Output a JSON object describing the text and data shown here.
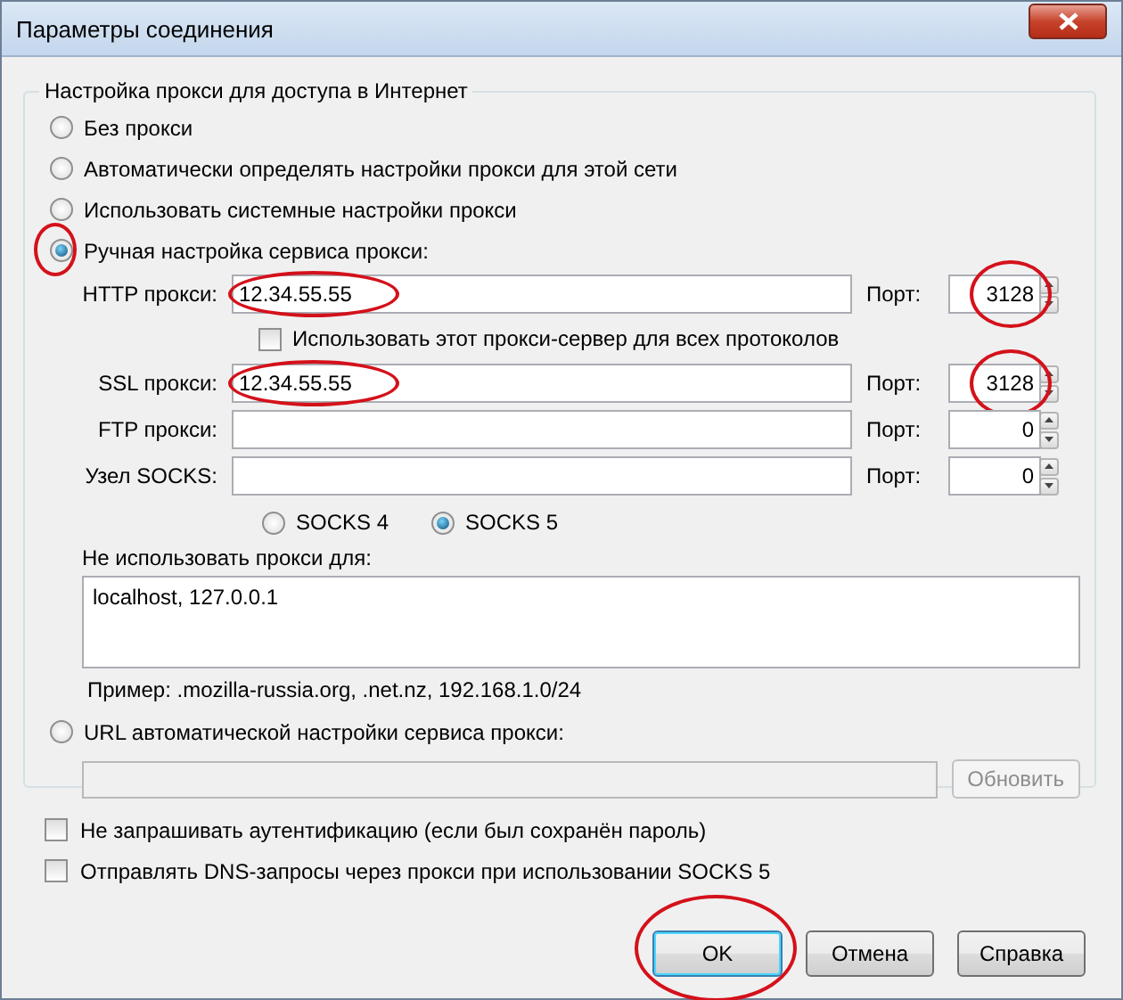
{
  "window": {
    "title": "Параметры соединения"
  },
  "group": {
    "title": "Настройка прокси для доступа в Интернет"
  },
  "proxy_modes": [
    {
      "label": "Без прокси",
      "selected": false,
      "highlighted": false
    },
    {
      "label": "Автоматически определять настройки прокси для этой сети",
      "selected": false,
      "highlighted": false
    },
    {
      "label": "Использовать системные настройки прокси",
      "selected": false,
      "highlighted": false
    },
    {
      "label": "Ручная настройка сервиса прокси:",
      "selected": true,
      "highlighted": true
    }
  ],
  "proxies": [
    {
      "label": "HTTP прокси:",
      "value": "12.34.55.55",
      "value_highlighted": true,
      "port_label": "Порт:",
      "port": "3128",
      "port_highlighted": true
    },
    {
      "label": "SSL прокси:",
      "value": "12.34.55.55",
      "value_highlighted": true,
      "port_label": "Порт:",
      "port": "3128",
      "port_highlighted": true
    },
    {
      "label": "FTP прокси:",
      "port_label": "Порт:",
      "port": "0",
      "value_highlighted": false,
      "port_highlighted": false
    },
    {
      "label": "Узел SOCKS:",
      "port_label": "Порт:",
      "port": "0",
      "value_highlighted": false,
      "port_highlighted": false
    }
  ],
  "use_for_all": {
    "label": "Использовать этот прокси-сервер для всех протоколов",
    "checked": false
  },
  "socks_versions": [
    {
      "label": "SOCKS 4",
      "selected": false
    },
    {
      "label": "SOCKS 5",
      "selected": true
    }
  ],
  "no_proxy": {
    "label": "Не использовать прокси для:",
    "value": "localhost, 127.0.0.1"
  },
  "example": "Пример: .mozilla-russia.org, .net.nz, 192.168.1.0/24",
  "auto_url": {
    "label": "URL автоматической настройки сервиса прокси:",
    "selected": false,
    "disabled": true,
    "reload_button": "Обновить"
  },
  "options": [
    {
      "label": "Не запрашивать аутентификацию (если был сохранён пароль)",
      "checked": false
    },
    {
      "label": "Отправлять DNS-запросы через прокси при использовании SOCKS 5",
      "checked": false
    }
  ],
  "buttons": [
    {
      "label": "OK",
      "default": true,
      "highlighted": true
    },
    {
      "label": "Отмена",
      "default": false,
      "highlighted": false
    },
    {
      "label": "Справка",
      "default": false,
      "highlighted": false
    }
  ]
}
